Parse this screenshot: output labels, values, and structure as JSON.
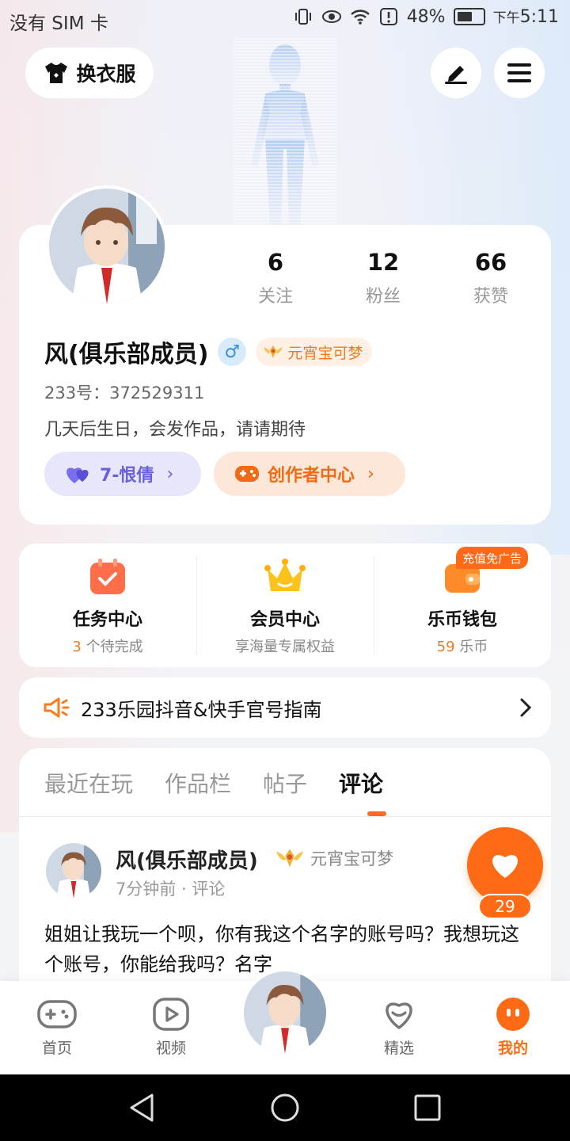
{
  "status_bar": {
    "carrier": "没有 SIM 卡",
    "battery": "48%",
    "time_prefix": "下午",
    "time": "5:11"
  },
  "top": {
    "outfit_label": "换衣服"
  },
  "profile": {
    "stats": [
      {
        "value": "6",
        "label": "关注"
      },
      {
        "value": "12",
        "label": "粉丝"
      },
      {
        "value": "66",
        "label": "获赞"
      }
    ],
    "name": "风(俱乐部成员)",
    "gender_symbol": "♂",
    "badge_label": "元宵宝可梦",
    "id_text": "233号：372529311",
    "bio": "几天后生日，会发作品，请请期待",
    "relation_label": "7-恨倩",
    "creator_label": "创作者中心"
  },
  "services": {
    "ad_tag": "充值免广告",
    "items": [
      {
        "title": "任务中心",
        "sub_highlight": "3",
        "sub_text": " 个待完成"
      },
      {
        "title": "会员中心",
        "sub_highlight": "",
        "sub_text": "享海量专属权益"
      },
      {
        "title": "乐币钱包",
        "sub_highlight": "59",
        "sub_text": " 乐币"
      }
    ]
  },
  "notice": {
    "text": "233乐园抖音&快手官号指南"
  },
  "tabs": [
    "最近在玩",
    "作品栏",
    "帖子",
    "评论"
  ],
  "comment": {
    "author": "风(俱乐部成员)",
    "badge": "元宵宝可梦",
    "meta": "7分钟前 · 评论",
    "text": "姐姐让我玩一个呗，你有我这个名字的账号吗？我想玩这个账号，你能给我吗？名字",
    "like_count": "29"
  },
  "bottom_nav": [
    {
      "label": "首页"
    },
    {
      "label": "视频"
    },
    {
      "label": "精选"
    },
    {
      "label": "我的"
    }
  ],
  "colors": {
    "accent": "#ff6a14",
    "relation": "#6a5fdc",
    "gender": "#3b8fe0"
  }
}
